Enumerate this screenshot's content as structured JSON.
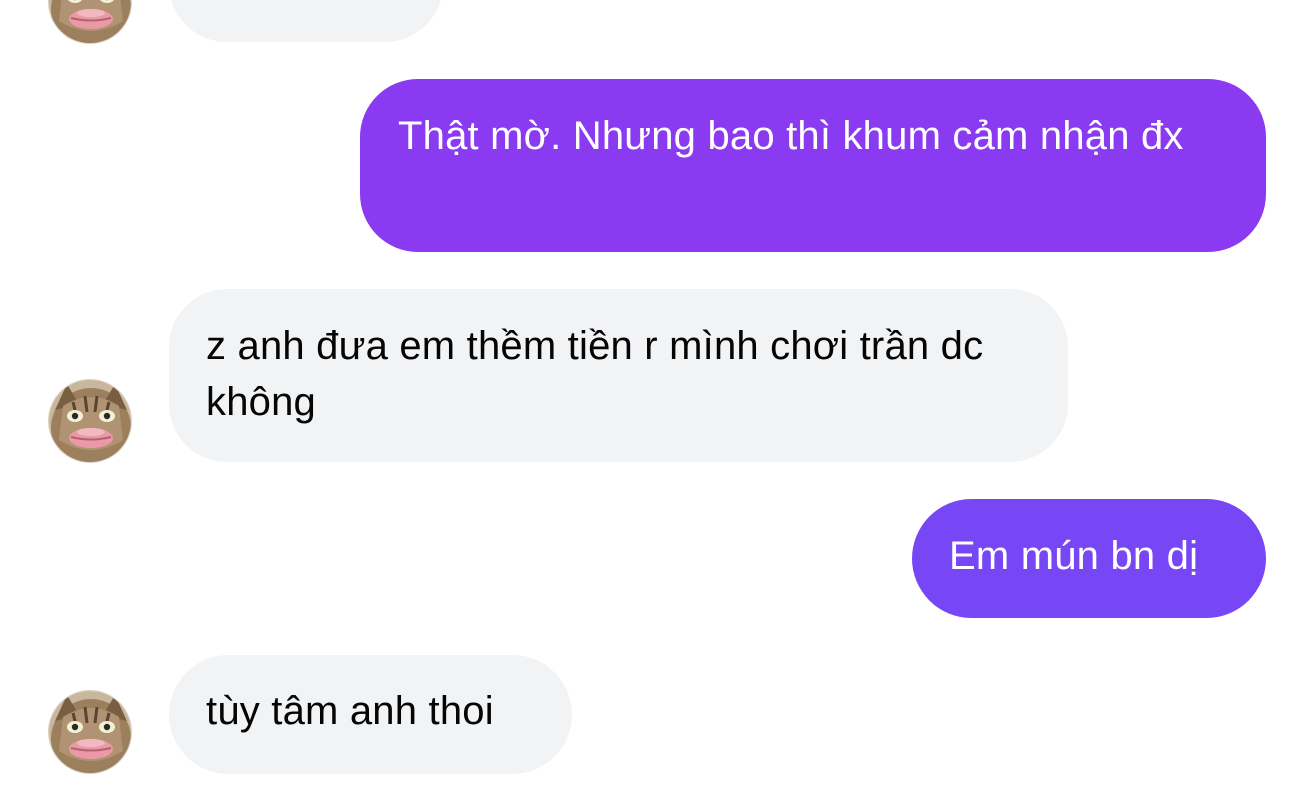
{
  "conversation": {
    "messages": [
      {
        "sender": "other",
        "text": ""
      },
      {
        "sender": "me",
        "text": "Thật mờ. Nhưng bao thì khum cảm nhận đx"
      },
      {
        "sender": "other",
        "text": "z anh đưa em thềm tiền r mình chơi trần dc không"
      },
      {
        "sender": "me",
        "text": "Em mún bn dị"
      },
      {
        "sender": "other",
        "text": "tùy tâm anh thoi"
      }
    ]
  },
  "colors": {
    "incoming_bubble": "#f2f3f5",
    "outgoing_bubble_top": "#8a3af0",
    "outgoing_bubble_bottom": "#7747f5",
    "text_dark": "#050505",
    "text_light": "#ffffff"
  },
  "avatar": {
    "icon": "cat-face-icon"
  }
}
